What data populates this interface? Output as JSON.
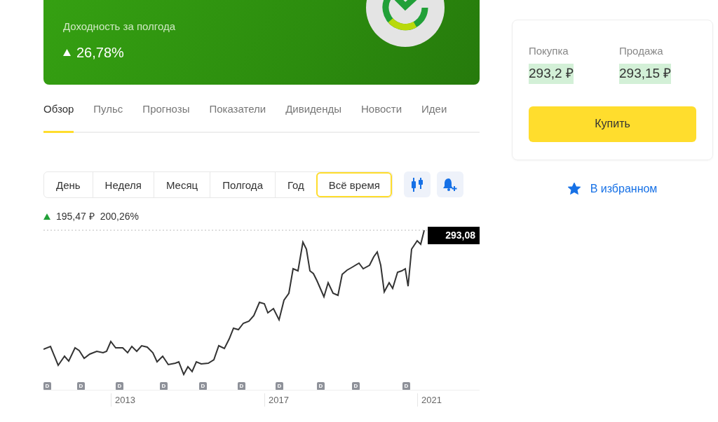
{
  "banner": {
    "label": "Доходность за полгода",
    "change": "26,78%"
  },
  "tabs": [
    {
      "label": "Обзор",
      "selected": true
    },
    {
      "label": "Пульс",
      "selected": false
    },
    {
      "label": "Прогнозы",
      "selected": false
    },
    {
      "label": "Показатели",
      "selected": false
    },
    {
      "label": "Дивиденды",
      "selected": false
    },
    {
      "label": "Новости",
      "selected": false
    },
    {
      "label": "Идеи",
      "selected": false
    }
  ],
  "periods": [
    {
      "label": "День",
      "selected": false
    },
    {
      "label": "Неделя",
      "selected": false
    },
    {
      "label": "Месяц",
      "selected": false
    },
    {
      "label": "Полгода",
      "selected": false
    },
    {
      "label": "Год",
      "selected": false
    },
    {
      "label": "Всё время",
      "selected": true
    }
  ],
  "stats": {
    "change": "195,47 ₽",
    "percent": "200,26%"
  },
  "chart": {
    "last_price": "293,08",
    "dividend_markers": [
      "D",
      "D",
      "D",
      "D",
      "D",
      "D",
      "D",
      "D",
      "D",
      "D"
    ],
    "years": [
      "2013",
      "2017",
      "2021"
    ]
  },
  "trade": {
    "buy_label": "Покупка",
    "buy_price": "293,2 ₽",
    "sell_label": "Продажа",
    "sell_price": "293,15 ₽",
    "buy_button": "Купить"
  },
  "favorite": {
    "label": "В избранном",
    "favorited": true
  }
}
